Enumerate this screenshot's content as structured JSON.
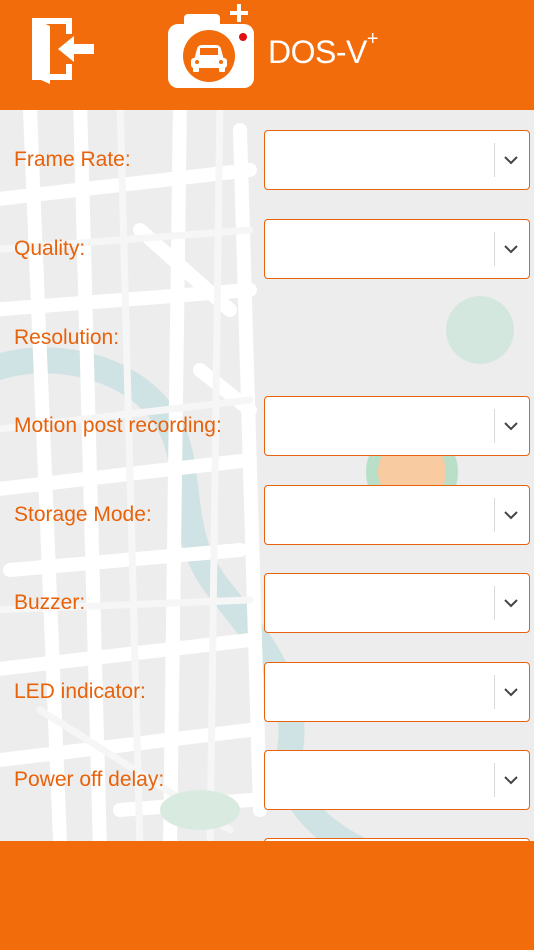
{
  "header": {
    "brand_main": "DOS-V",
    "brand_sup": "+",
    "exit_icon": "exit-door-icon",
    "logo_icon": "camera-car-icon",
    "accent": "#f36c0c"
  },
  "settings": [
    {
      "label": "Frame Rate:",
      "value": "",
      "has_select": true
    },
    {
      "label": "Quality:",
      "value": "",
      "has_select": true
    },
    {
      "label": "Resolution:",
      "value": "",
      "has_select": false
    },
    {
      "label": "Motion post recording:",
      "value": "",
      "has_select": true
    },
    {
      "label": "Storage Mode:",
      "value": "",
      "has_select": true
    },
    {
      "label": "Buzzer:",
      "value": "",
      "has_select": true
    },
    {
      "label": "LED indicator:",
      "value": "",
      "has_select": true
    },
    {
      "label": "Power off delay:",
      "value": "",
      "has_select": true
    }
  ],
  "colors": {
    "label": "#e8620a",
    "border": "#e8620a",
    "footer": "#f36c0c"
  }
}
